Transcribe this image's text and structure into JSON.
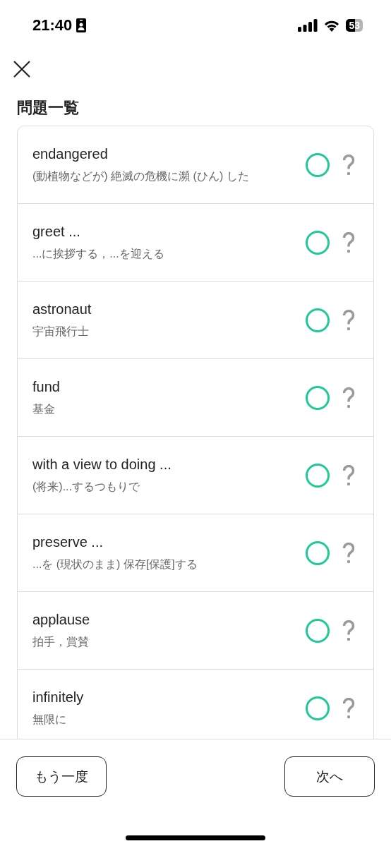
{
  "status_bar": {
    "time": "21:40",
    "battery": "53"
  },
  "title": "問題一覧",
  "items": [
    {
      "word": "endangered",
      "meaning": "(動植物などが) 絶滅の危機に瀕 (ひん) した"
    },
    {
      "word": "greet ...",
      "meaning": "...に挨拶する，...を迎える"
    },
    {
      "word": "astronaut",
      "meaning": "宇宙飛行士"
    },
    {
      "word": "fund",
      "meaning": "基金"
    },
    {
      "word": "with a view to doing ...",
      "meaning": "(将来)...するつもりで"
    },
    {
      "word": "preserve ...",
      "meaning": "...を (現状のまま) 保存[保護]する"
    },
    {
      "word": "applause",
      "meaning": "拍手，賞賛"
    },
    {
      "word": "infinitely",
      "meaning": "無限に"
    }
  ],
  "buttons": {
    "retry": "もう一度",
    "next": "次へ"
  }
}
